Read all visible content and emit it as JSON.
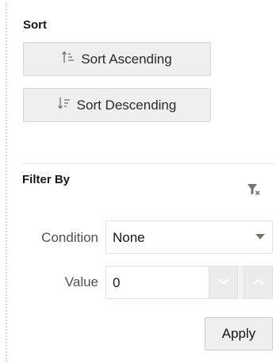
{
  "sort": {
    "title": "Sort",
    "ascending_label": "Sort Ascending",
    "ascending_icon": "sort-ascending-icon",
    "descending_label": "Sort Descending",
    "descending_icon": "sort-descending-icon"
  },
  "filter": {
    "title": "Filter By",
    "clear_icon": "clear-filter-icon",
    "condition": {
      "label": "Condition",
      "selected": "None"
    },
    "value": {
      "label": "Value",
      "current": "0"
    },
    "apply_label": "Apply"
  },
  "colors": {
    "button_bg": "#f1efed",
    "border": "#e2dfdb",
    "text": "#161513",
    "label_text": "#52504d",
    "icon": "#77736f"
  }
}
